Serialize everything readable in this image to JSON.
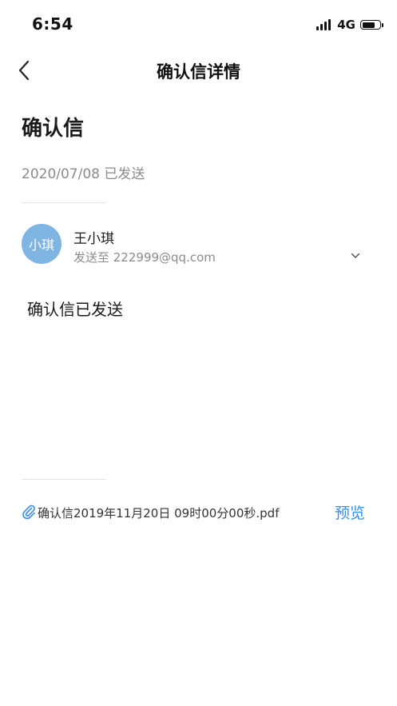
{
  "status_bar": {
    "time": "6:54",
    "network": "4G",
    "battery_level": 0.75
  },
  "nav": {
    "title": "确认信详情"
  },
  "letter": {
    "title": "确认信",
    "sent_meta": "2020/07/08 已发送",
    "body": "确认信已发送"
  },
  "recipient": {
    "avatar_text": "小琪",
    "avatar_color": "#7fb5e3",
    "name": "王小琪",
    "email_line": "发送至 222999@qq.com"
  },
  "attachment": {
    "file_name": "确认信2019年11月20日 09时00分00秒.pdf",
    "preview_label": "预览",
    "accent_color": "#3a8ee6"
  },
  "icons": {
    "back": "chevron-left-icon",
    "expand": "chevron-down-icon",
    "attachment": "paperclip-icon"
  }
}
